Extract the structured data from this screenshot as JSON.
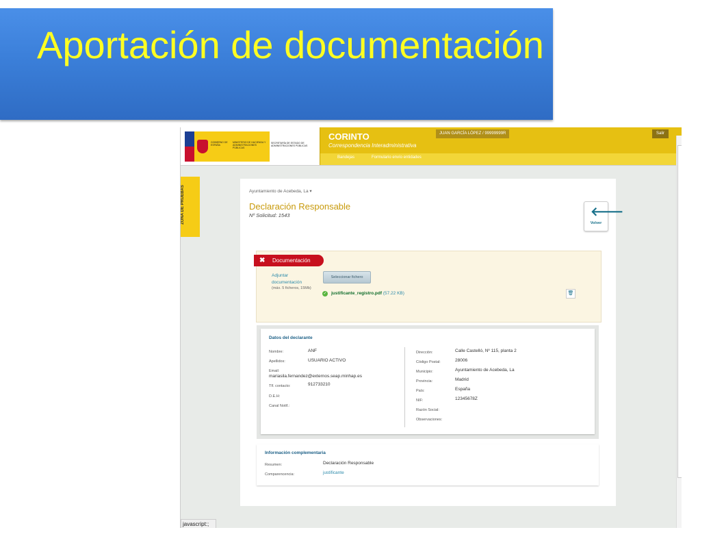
{
  "slide": {
    "title": "Aportación de documentación"
  },
  "header": {
    "logo_left": "GOBIERNO DE ESPAÑA",
    "logo_ministry": "MINISTERIO DE HACIENDA Y ADMINISTRACIONES PÚBLICAS",
    "secretaria": "SECRETARÍA DE ESTADO DE ADMINISTRACIONES PÚBLICAS",
    "app_name": "CORINTO",
    "app_subtitle": "Correspondencia Interadministrativa",
    "nav": [
      "Bandejas",
      "Formulario envío entidades"
    ],
    "user": "JUAN GARCÍA LÓPEZ / 99999999R",
    "logout": "Salir"
  },
  "zona": "ZONA DE PRUEBAS",
  "page": {
    "breadcrumb": "Ayuntamiento de Acebeda, La ▾",
    "title": "Declaración Responsable",
    "subtitle": "Nº Solicitud: 1543",
    "back_label": "Volver"
  },
  "documentacion": {
    "tab_label": "Documentación",
    "attach_label": "Adjuntar documentación",
    "max_note": "(máx. 5 ficheros, 15Mb)",
    "select_button": "Seleccionar fichero",
    "file_name": "justificante_registro.pdf",
    "file_size": "(57.22 KB)"
  },
  "declarante": {
    "title": "Datos del declarante",
    "left": [
      {
        "label": "Nombre:",
        "value": "ANF"
      },
      {
        "label": "Apellidos:",
        "value": "USUARIO ACTIVO"
      },
      {
        "label": "Email:",
        "value": "mariasila.fernandez@externos.seap.minhap.es"
      },
      {
        "label": "Tlf. contacto:",
        "value": "912733210"
      },
      {
        "label": "D.E.H:",
        "value": ""
      },
      {
        "label": "Canal Notif.:",
        "value": ""
      }
    ],
    "right": [
      {
        "label": "Dirección:",
        "value": "Calle Castelló, Nº 115, planta 2"
      },
      {
        "label": "Código Postal:",
        "value": "28006"
      },
      {
        "label": "Municipio:",
        "value": "Ayuntamiento de Acebeda, La"
      },
      {
        "label": "Provincia:",
        "value": "Madrid"
      },
      {
        "label": "País:",
        "value": "España"
      },
      {
        "label": "NIF:",
        "value": "12345678Z"
      },
      {
        "label": "Razón Social:",
        "value": ""
      },
      {
        "label": "Observaciones:",
        "value": ""
      }
    ]
  },
  "complementaria": {
    "title": "Información complementaria",
    "resumen_label": "Resumen:",
    "resumen_value": "Declaración Responsable",
    "comparencia_label": "Comparencencia:",
    "comparencia_value": "justificante"
  },
  "statusbar": "javascript:;"
}
